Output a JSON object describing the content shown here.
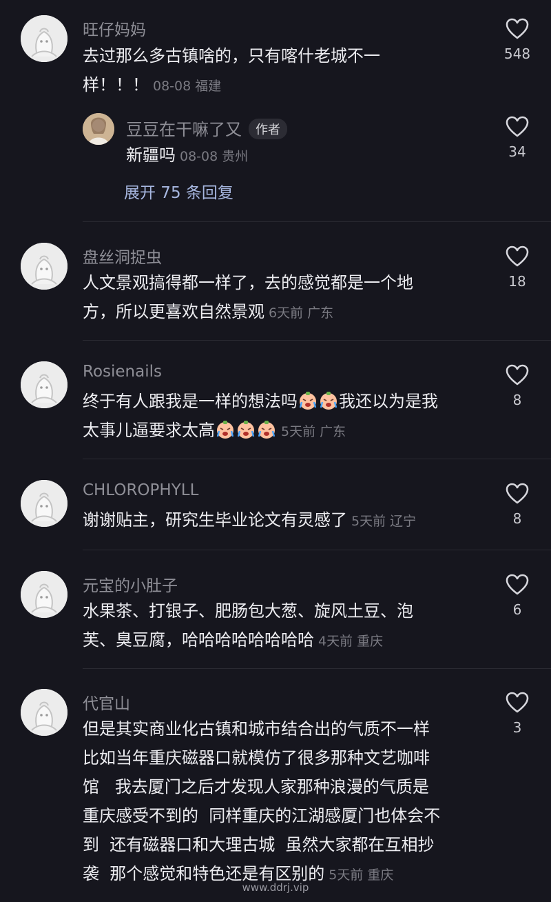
{
  "comments": [
    {
      "username": "旺仔妈妈",
      "text": "去过那么多古镇啥的，只有喀什老城不一样！！！",
      "time": "08-08",
      "location": "福建",
      "likes": "548",
      "reply": {
        "username": "豆豆在干嘛了又",
        "tag": "作者",
        "text": "新疆吗",
        "time": "08-08",
        "location": "贵州",
        "likes": "34"
      },
      "expand_label": "展开 75 条回复"
    },
    {
      "username": "盘丝洞捉虫",
      "line1": "人文景观搞得都一样了，去的感觉都是一个地",
      "line2": "方，所以更喜欢自然景观",
      "time": "6天前",
      "location": "广东",
      "likes": "18"
    },
    {
      "username": "Rosienails",
      "line1a": "终于有人跟我是一样的想法吗",
      "line1b": "我还以为是我",
      "line2": "太事儿逼要求太高",
      "time": "5天前",
      "location": "广东",
      "likes": "8",
      "emoji": "crying-face-emoji"
    },
    {
      "username": "CHLOROPHYLL",
      "text": "谢谢贴主，研究生毕业论文有灵感了",
      "time": "5天前",
      "location": "辽宁",
      "likes": "8"
    },
    {
      "username": "元宝的小肚子",
      "line1": "水果茶、打银子、肥肠包大葱、旋风土豆、泡",
      "line2": "芙、臭豆腐，哈哈哈哈哈哈哈哈",
      "time": "4天前",
      "location": "重庆",
      "likes": "6"
    },
    {
      "username": "代官山",
      "lines": [
        "但是其实商业化古镇和城市结合出的气质不一样",
        "比如当年重庆磁器口就模仿了很多那种文艺咖啡",
        "馆   我去厦门之后才发现人家那种浪漫的气质是",
        "重庆感受不到的  同样重庆的江湖感厦门也体会不",
        "到  还有磁器口和大理古城  虽然大家都在互相抄",
        "袭  那个感觉和特色还是有区别的"
      ],
      "time": "5天前",
      "location": "重庆",
      "likes": "3"
    }
  ],
  "watermark": "www.ddrj.vip",
  "colors": {
    "background": "#16161e",
    "username": "#8e8e96",
    "meta": "#7a7a82",
    "expand_link": "#a7b7e0"
  },
  "icons": {
    "like": "heart-outline-icon",
    "avatar": "default-avatar-icon"
  }
}
